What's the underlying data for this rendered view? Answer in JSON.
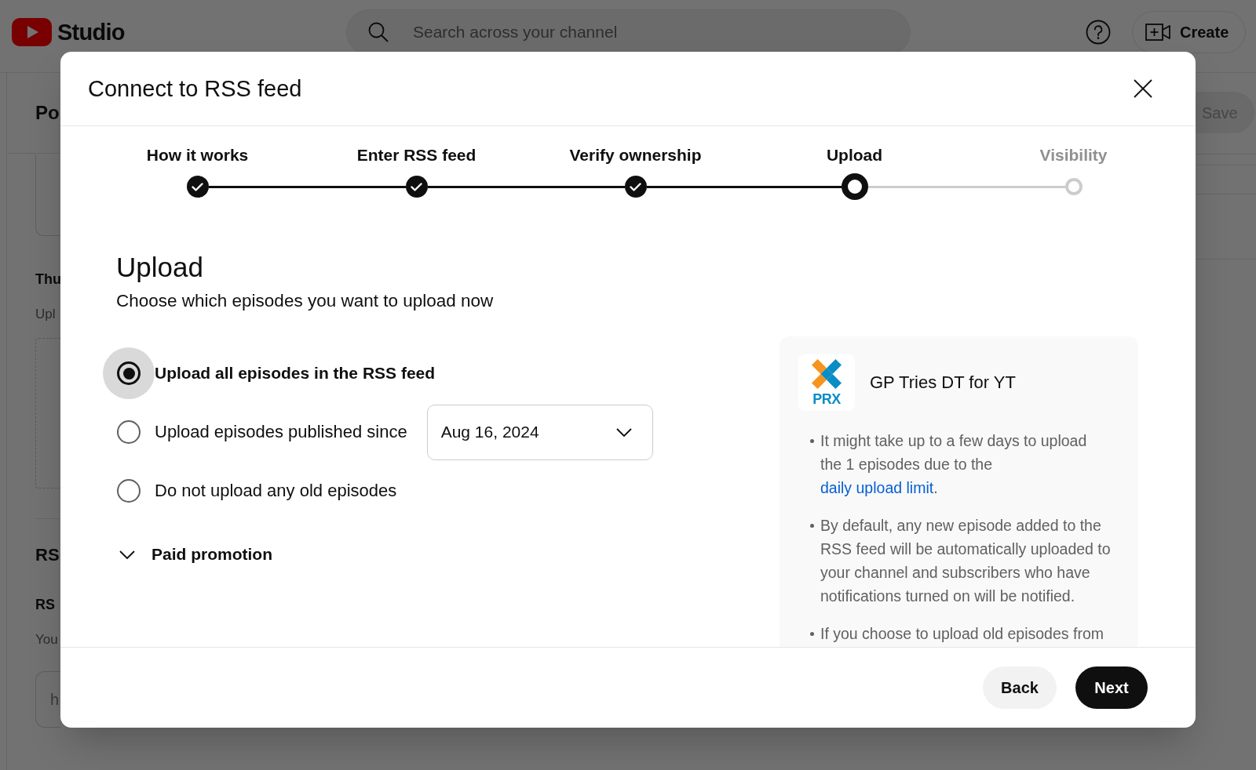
{
  "studio_header": {
    "logo_text": "Studio",
    "search": {
      "placeholder": "Search across your channel"
    },
    "create_button": "Create"
  },
  "page_behind": {
    "title": "Po",
    "label_1": "Thu",
    "hint_1": "Upl",
    "heading_2": "RS",
    "label_2": "RS",
    "hint_2": "You",
    "input_value": "h",
    "save_button": "Save"
  },
  "dialog": {
    "title": "Connect to RSS feed",
    "steps": [
      {
        "label": "How it works",
        "completed": true,
        "selected": false
      },
      {
        "label": "Enter RSS feed",
        "completed": true,
        "selected": false
      },
      {
        "label": "Verify ownership",
        "completed": true,
        "selected": false
      },
      {
        "label": "Upload",
        "completed": false,
        "selected": true
      },
      {
        "label": "Visibility",
        "completed": false,
        "selected": false
      }
    ],
    "heading": "Upload",
    "subtitle": "Choose which episodes you want to upload now",
    "options": [
      {
        "label": "Upload all episodes in the RSS feed",
        "selected": true
      },
      {
        "label": "Upload episodes published since",
        "selected": false,
        "date": "Aug 16, 2024"
      },
      {
        "label": "Do not upload any old episodes",
        "selected": false
      }
    ],
    "paid_promotion": {
      "label": "Paid promotion",
      "expanded": false
    },
    "info_card": {
      "logo_text": "PRX",
      "name": "GP Tries DT for YT",
      "bullets": [
        {
          "text": "It might take up to a few days to upload the 1 episodes due to the ",
          "link": "daily upload limit",
          "after": "."
        },
        {
          "text": "By default, any new episode added to the RSS feed will be automatically uploaded to your channel and subscribers who have notifications turned on will be notified."
        },
        {
          "text": "If you choose to upload old episodes from"
        }
      ]
    },
    "buttons": [
      {
        "label": "Back",
        "kind": "secondary"
      },
      {
        "label": "Next",
        "kind": "primary"
      }
    ]
  }
}
